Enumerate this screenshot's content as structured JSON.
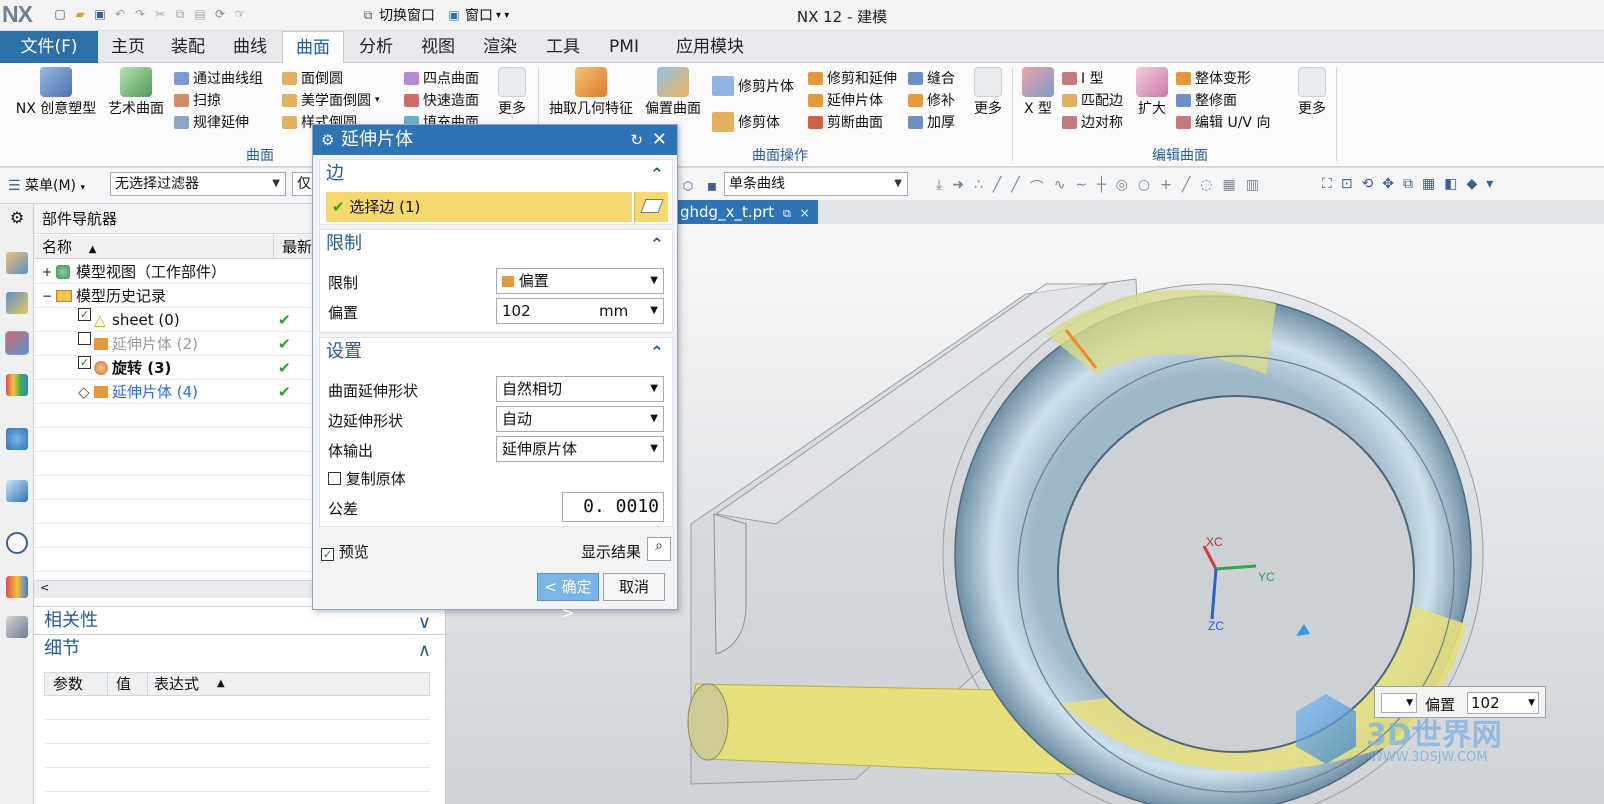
{
  "app": {
    "logo": "NX",
    "title": "NX 12 - 建模",
    "switch_window": "切换窗口",
    "window_menu": "窗口"
  },
  "file_menu": "文件(F)",
  "tabs": [
    "主页",
    "装配",
    "曲线",
    "曲面",
    "分析",
    "视图",
    "渲染",
    "工具",
    "PMI",
    "应用模块"
  ],
  "active_tab": "曲面",
  "ribbon": {
    "nx_creative": "NX 创意塑型",
    "art_surface": "艺术曲面",
    "group1_small": [
      "通过曲线组",
      "扫掠",
      "规律延伸"
    ],
    "group1_label": "曲面",
    "group2_small": [
      "面倒圆",
      "美学面倒圆",
      "样式倒圆"
    ],
    "group3_small": [
      "四点曲面",
      "快速造面",
      "填充曲面"
    ],
    "more": "更多",
    "extract_geom": "抽取几何特征",
    "offset_surface": "偏置曲面",
    "trim_sheet": "修剪片体",
    "trim_body": "修剪体",
    "ops_small": [
      "修剪和延伸",
      "延伸片体",
      "剪断曲面"
    ],
    "ops_small2": [
      "缝合",
      "修补",
      "加厚"
    ],
    "ops_label": "曲面操作",
    "x_type": "X 型",
    "edit_small": [
      "I 型",
      "匹配边",
      "边对称"
    ],
    "enlarge": "扩大",
    "edit_small2": [
      "整体变形",
      "整修面",
      "编辑 U/V 向"
    ],
    "edit_label": "编辑曲面"
  },
  "toolbar": {
    "menu": "菜单(M)",
    "filter": "无选择过滤器",
    "only": "仅",
    "curve_rule": "单条曲线"
  },
  "navigator": {
    "title": "部件导航器",
    "col_name": "名称",
    "col_latest": "最新",
    "rows": [
      {
        "label": "模型视图（工作部件）",
        "check": false
      },
      {
        "label": "模型历史记录",
        "check": false
      },
      {
        "label": "sheet (0)",
        "check": true
      },
      {
        "label": "延伸片体 (2)",
        "check": true
      },
      {
        "label": "旋转 (3)",
        "check": true
      },
      {
        "label": "延伸片体 (4)",
        "check": true
      }
    ]
  },
  "dependency_panel": "相关性",
  "details_panel": {
    "title": "细节",
    "cols": [
      "参数",
      "值",
      "表达式"
    ]
  },
  "file_tab": "ghdg_x_t.prt",
  "dialog": {
    "title": "延伸片体",
    "edge_section": "边",
    "select_edge": "选择边 (1)",
    "limit_section": "限制",
    "limit_label": "限制",
    "limit_value": "偏置",
    "offset_label": "偏置",
    "offset_value": "102",
    "offset_unit": "mm",
    "settings_section": "设置",
    "surface_shape_label": "曲面延伸形状",
    "surface_shape_value": "自然相切",
    "edge_shape_label": "边延伸形状",
    "edge_shape_value": "自动",
    "body_output_label": "体输出",
    "body_output_value": "延伸原片体",
    "copy_original": "复制原体",
    "tolerance_label": "公差",
    "tolerance_value": "0. 0010",
    "preview": "预览",
    "show_result": "显示结果",
    "ok": "< 确定 >",
    "cancel": "取消"
  },
  "axes": {
    "xc": "XC",
    "yc": "YC",
    "zc": "ZC"
  },
  "onscreen_input": {
    "label": "偏置",
    "value": "102"
  },
  "watermark": {
    "brand": "3D世界网",
    "url": "WWW.3DSJW.COM"
  },
  "colors": {
    "accent": "#2e74b5",
    "file_tab": "#2d6fa7",
    "selection": "#f5d86e",
    "highlight_yellow": "#e5e07a"
  }
}
